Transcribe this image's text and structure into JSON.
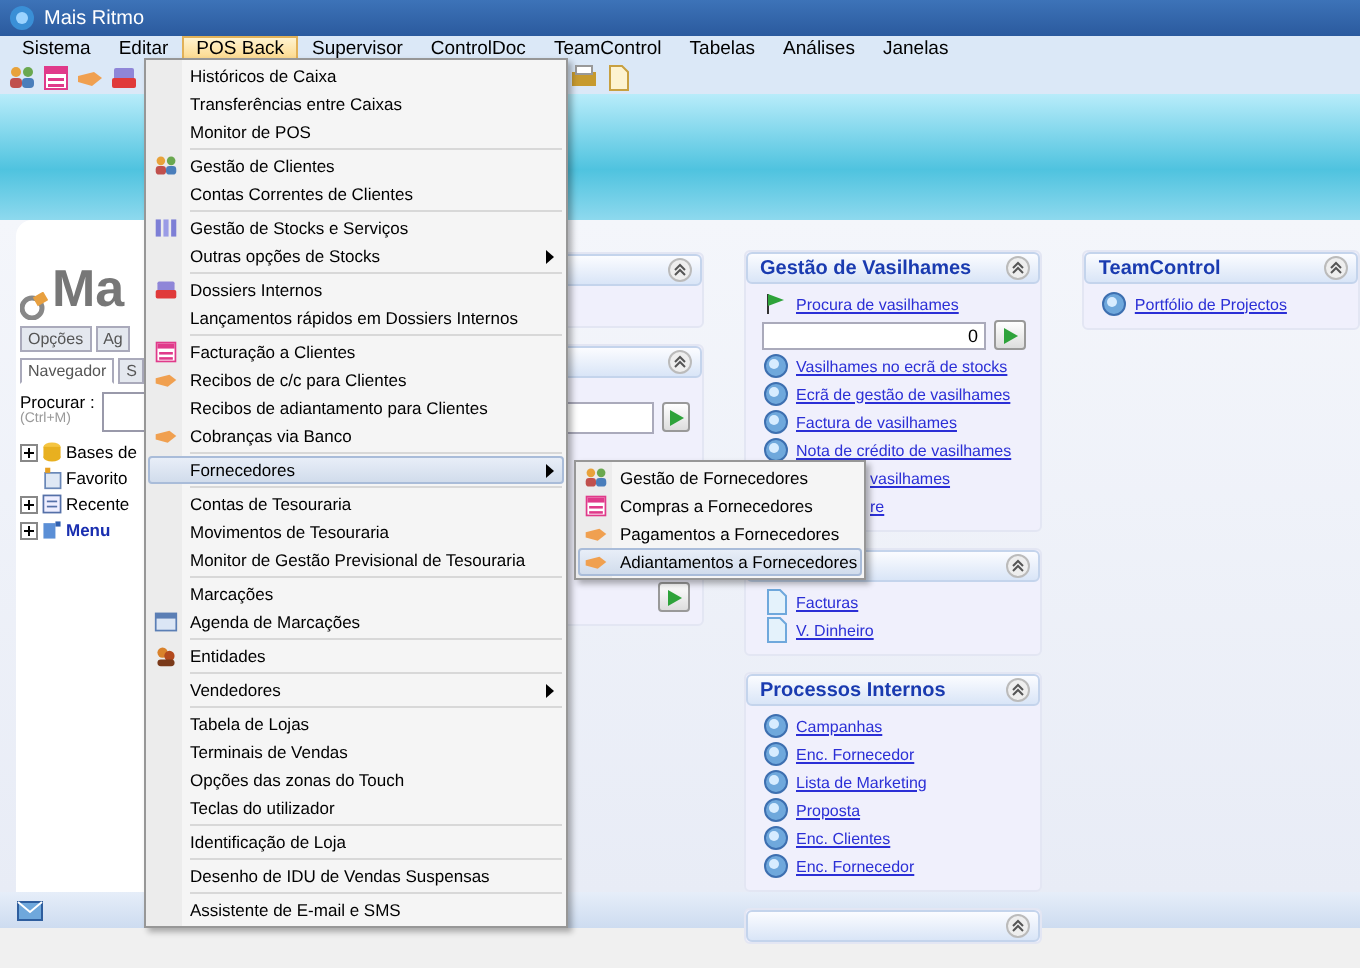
{
  "window": {
    "title": "Mais Ritmo"
  },
  "menu_bar": [
    {
      "label": "Sistema",
      "selected": false
    },
    {
      "label": "Editar",
      "selected": false
    },
    {
      "label": "POS Back",
      "selected": true
    },
    {
      "label": "Supervisor",
      "selected": false
    },
    {
      "label": "ControlDoc",
      "selected": false
    },
    {
      "label": "TeamControl",
      "selected": false
    },
    {
      "label": "Tabelas",
      "selected": false
    },
    {
      "label": "Análises",
      "selected": false
    },
    {
      "label": "Janelas",
      "selected": false
    }
  ],
  "navigator": {
    "logo": "Ma",
    "top_tabs": [
      {
        "label": "Opções",
        "selected": false
      },
      {
        "label": "Ag",
        "selected": false
      }
    ],
    "tabs": [
      {
        "label": "Navegador",
        "selected": true
      },
      {
        "label": "S",
        "selected": false
      }
    ],
    "search_label": "Procurar :",
    "search_hint": "(Ctrl+M)",
    "tree": [
      {
        "label": "Bases de",
        "kind": "database",
        "expandable": true
      },
      {
        "label": "Favorito",
        "kind": "favorites",
        "expandable": false
      },
      {
        "label": "Recente",
        "kind": "recent",
        "expandable": true
      },
      {
        "label": "Menu",
        "kind": "menu",
        "expandable": true
      }
    ]
  },
  "dashboard": {
    "columns": [
      [
        {
          "title": "Gestão de Vasilhames",
          "items": [
            {
              "kind": "flag",
              "label": "Procura de vasilhames"
            },
            {
              "kind": "field",
              "value": "0"
            },
            {
              "kind": "link",
              "label": "Vasilhames no ecrã de stocks"
            },
            {
              "kind": "link",
              "label": "Ecrã de gestão de vasilhames"
            },
            {
              "kind": "link",
              "label": "Factura de vasilhames"
            },
            {
              "kind": "link",
              "label": "Nota de crédito de vasilhames"
            },
            {
              "kind": "partial",
              "label": "vasilhames"
            },
            {
              "kind": "partial",
              "label": "re"
            }
          ]
        },
        {
          "items": [
            {
              "kind": "doc",
              "label": "Facturas"
            },
            {
              "kind": "doc",
              "label": "V. Dinheiro"
            }
          ]
        },
        {
          "title": "Processos Internos",
          "items": [
            {
              "kind": "link",
              "label": "Campanhas"
            },
            {
              "kind": "link",
              "label": "Enc. Fornecedor"
            },
            {
              "kind": "link",
              "label": "Lista de Marketing"
            },
            {
              "kind": "link",
              "label": "Proposta"
            },
            {
              "kind": "link",
              "label": "Enc. Clientes"
            },
            {
              "kind": "link",
              "label": "Enc. Fornecedor"
            }
          ]
        },
        {}
      ],
      [
        {
          "title": "TeamControl",
          "items": [
            {
              "kind": "link",
              "label": "Portfólio de Projectos"
            }
          ]
        }
      ]
    ]
  },
  "dropdown": {
    "groups": [
      [
        {
          "label": "Históricos de Caixa",
          "kind": "plain",
          "selected": false
        },
        {
          "label": "Transferências entre Caixas",
          "kind": "plain",
          "selected": false
        },
        {
          "label": "Monitor de POS",
          "kind": "plain",
          "selected": false
        }
      ],
      [
        {
          "label": "Gestão de Clientes",
          "kind": "people",
          "selected": false
        },
        {
          "label": "Contas Correntes de Clientes",
          "kind": "plain",
          "selected": false
        }
      ],
      [
        {
          "label": "Gestão de Stocks e Serviços",
          "kind": "stock",
          "selected": false
        },
        {
          "label": "Outras opções de Stocks",
          "kind": "submenu",
          "selected": false
        }
      ],
      [
        {
          "label": "Dossiers Internos",
          "kind": "dossier",
          "selected": false
        },
        {
          "label": "Lançamentos rápidos em Dossiers Internos",
          "kind": "plain",
          "selected": false
        }
      ],
      [
        {
          "label": "Facturação a Clientes",
          "kind": "invoice",
          "selected": false
        },
        {
          "label": "Recibos de c/c para Clientes",
          "kind": "payment",
          "selected": false
        },
        {
          "label": "Recibos de adiantamento para Clientes",
          "kind": "plain",
          "selected": false
        },
        {
          "label": "Cobranças via Banco",
          "kind": "payment",
          "selected": false
        }
      ],
      [
        {
          "label": "Fornecedores",
          "kind": "submenu",
          "selected": true
        }
      ],
      [
        {
          "label": "Contas de Tesouraria",
          "kind": "plain",
          "selected": false
        },
        {
          "label": "Movimentos de Tesouraria",
          "kind": "plain",
          "selected": false
        },
        {
          "label": "Monitor de Gestão Previsional de Tesouraria",
          "kind": "plain",
          "selected": false
        }
      ],
      [
        {
          "label": "Marcações",
          "kind": "plain",
          "selected": false
        },
        {
          "label": "Agenda de Marcações",
          "kind": "calendar",
          "selected": false
        }
      ],
      [
        {
          "label": "Entidades",
          "kind": "entities",
          "selected": false
        }
      ],
      [
        {
          "label": "Vendedores",
          "kind": "submenu",
          "selected": false
        }
      ],
      [
        {
          "label": "Tabela de Lojas",
          "kind": "plain",
          "selected": false
        },
        {
          "label": "Terminais de Vendas",
          "kind": "plain",
          "selected": false
        },
        {
          "label": "Opções das zonas do Touch",
          "kind": "plain",
          "selected": false
        },
        {
          "label": "Teclas do utilizador",
          "kind": "plain",
          "selected": false
        }
      ],
      [
        {
          "label": "Identificação de Loja",
          "kind": "plain",
          "selected": false
        }
      ],
      [
        {
          "label": "Desenho de IDU de Vendas Suspensas",
          "kind": "plain",
          "selected": false
        }
      ],
      [
        {
          "label": "Assistente de E-mail e SMS",
          "kind": "plain",
          "selected": false
        }
      ]
    ]
  },
  "submenu": {
    "items": [
      {
        "label": "Gestão de Fornecedores",
        "kind": "people",
        "selected": false
      },
      {
        "label": "Compras a Fornecedores",
        "kind": "invoice",
        "selected": false
      },
      {
        "label": "Pagamentos a Fornecedores",
        "kind": "payment",
        "selected": false
      },
      {
        "label": "Adiantamentos a Fornecedores",
        "kind": "payment",
        "selected": true
      }
    ]
  }
}
